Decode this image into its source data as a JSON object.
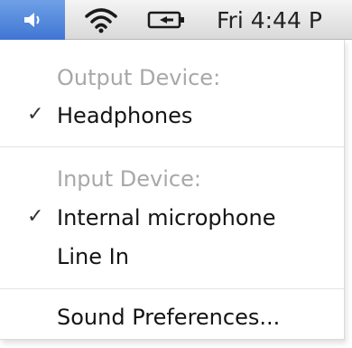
{
  "menubar": {
    "icons": [
      "volume-icon",
      "wifi-icon",
      "battery-icon"
    ],
    "clock": "Fri 4:44 P"
  },
  "menu": {
    "output_label": "Output Device:",
    "output_items": [
      {
        "label": "Headphones",
        "checked": true
      }
    ],
    "input_label": "Input Device:",
    "input_items": [
      {
        "label": "Internal microphone",
        "checked": true
      },
      {
        "label": "Line In",
        "checked": false
      }
    ],
    "check_mark": "✓",
    "preferences": "Sound Preferences..."
  },
  "colors": {
    "highlight": "#4a80d8",
    "disabled_text": "#a8a8a8"
  }
}
